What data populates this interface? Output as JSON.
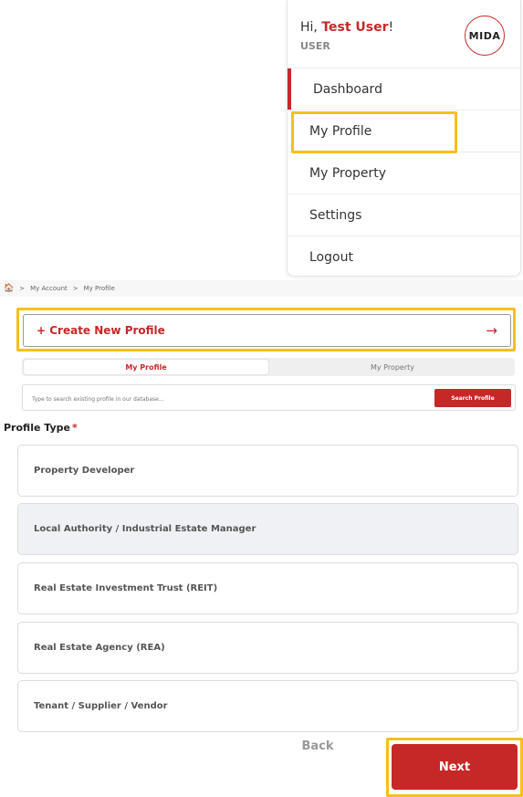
{
  "user_menu": {
    "greeting_prefix": "Hi, ",
    "user_name": "Test User",
    "greeting_suffix": "!",
    "role": "USER",
    "logo_text": "MIDA",
    "items": [
      {
        "label": "Dashboard"
      },
      {
        "label": "My Profile"
      },
      {
        "label": "My Property"
      },
      {
        "label": "Settings"
      },
      {
        "label": "Logout"
      }
    ]
  },
  "breadcrumb": {
    "items": [
      "My Account",
      "My Profile"
    ],
    "separator": ">"
  },
  "create_profile": {
    "label": "+ Create New Profile",
    "arrow": "→"
  },
  "tabs": [
    {
      "label": "My Profile",
      "active": true
    },
    {
      "label": "My Property",
      "active": false
    }
  ],
  "search": {
    "placeholder": "Type to search existing profile in our database...",
    "button_label": "Search Profile"
  },
  "profile_type": {
    "label": "Profile Type",
    "required_mark": "*",
    "options": [
      {
        "label": "Property Developer",
        "selected": false
      },
      {
        "label": "Local Authority / Industrial Estate Manager",
        "selected": true
      },
      {
        "label": "Real Estate Investment Trust (REIT)",
        "selected": false
      },
      {
        "label": "Real Estate Agency (REA)",
        "selected": false
      },
      {
        "label": "Tenant / Supplier / Vendor",
        "selected": false
      }
    ]
  },
  "footer": {
    "back_label": "Back",
    "next_label": "Next"
  },
  "colors": {
    "brand_red": "#c62828",
    "highlight_yellow": "#f6bf1e"
  }
}
